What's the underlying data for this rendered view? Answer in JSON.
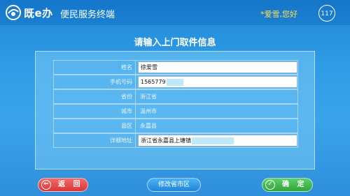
{
  "header": {
    "logo_text": "既e办",
    "app_title": "便民服务终端",
    "greeting": "*爱雪,您好",
    "countdown": "117"
  },
  "page_title": "请输入上门取件信息",
  "form": {
    "rows": [
      {
        "label": "姓名",
        "value": "徐爱雪",
        "type": "input"
      },
      {
        "label": "手机号码",
        "value": "1565779",
        "type": "input",
        "masked": true
      },
      {
        "label": "省份",
        "value": "浙江省",
        "type": "text"
      },
      {
        "label": "城市",
        "value": "温州市",
        "type": "text"
      },
      {
        "label": "县区",
        "value": "永嘉县",
        "type": "text"
      },
      {
        "label": "详细地址",
        "value": "浙江省永嘉县上塘镇",
        "type": "input",
        "masked": true
      }
    ]
  },
  "buttons": {
    "back": "返 回",
    "edit_region": "修改省市区",
    "confirm": "确 定"
  },
  "colors": {
    "greeting": "#ffe04a",
    "back": "#e04545",
    "edit": "#2b95e6",
    "confirm": "#3cb648"
  }
}
